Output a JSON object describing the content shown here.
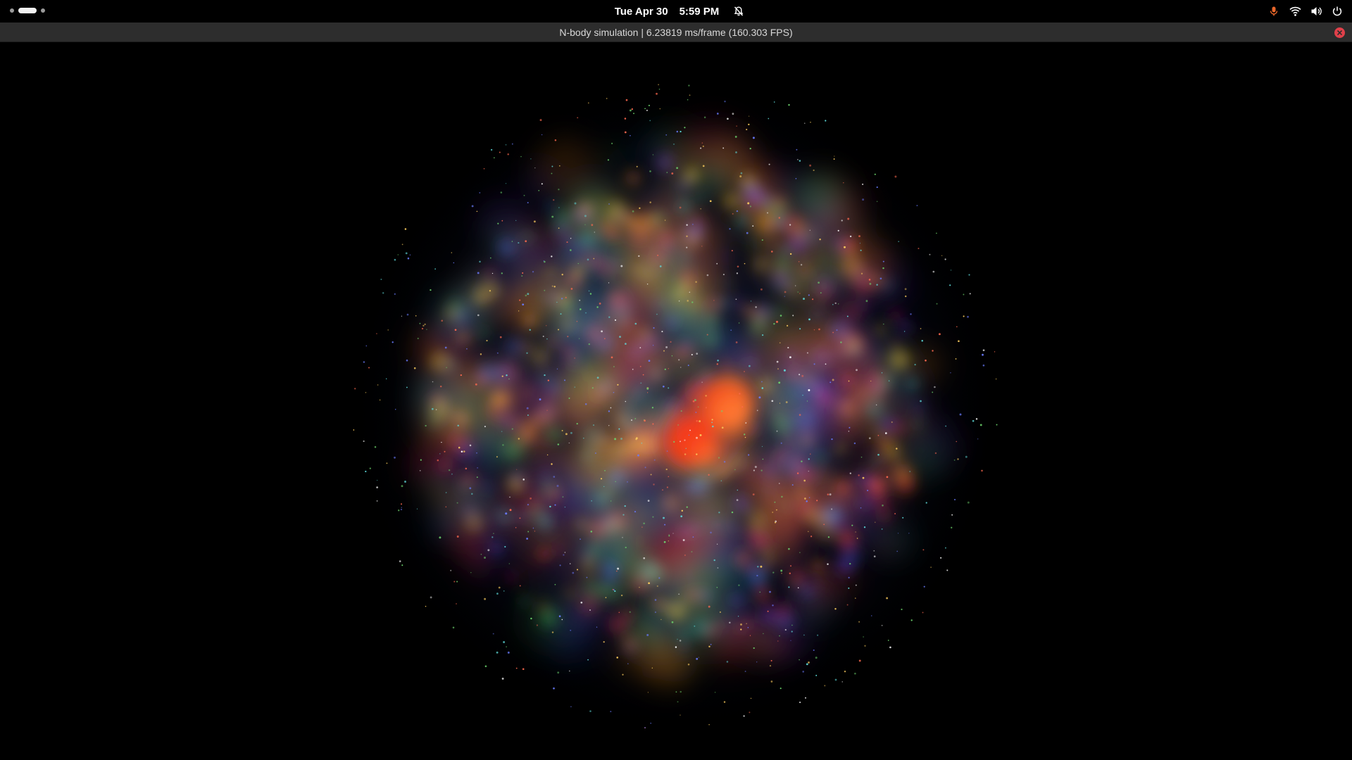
{
  "top_bar": {
    "date": "Tue Apr 30",
    "time": "5:59 PM",
    "icons": {
      "notifications": "bell-off-icon",
      "microphone": "microphone-icon",
      "network": "wifi-icon",
      "volume": "volume-icon",
      "power": "power-icon"
    },
    "accent_mic_color": "#e8662a"
  },
  "window": {
    "title": "N-body simulation | 6.23819 ms/frame (160.303 FPS)",
    "close_icon": "close-icon",
    "close_color": "#e0404a"
  },
  "simulation": {
    "background_color": "#000000",
    "palette": [
      "#ff3a1a",
      "#ff8a1a",
      "#f0c020",
      "#3ca83c",
      "#28a0a0",
      "#2850d8",
      "#6030c0",
      "#c02040"
    ]
  }
}
